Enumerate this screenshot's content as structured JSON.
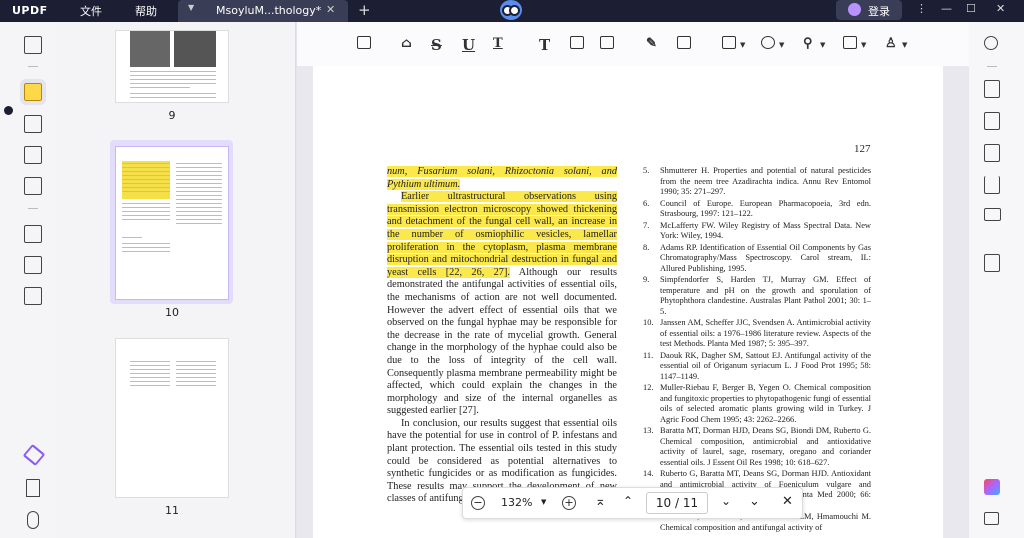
{
  "titlebar": {
    "logo": "UPDF",
    "menu_file": "文件",
    "menu_help": "帮助",
    "tab_title": "MsoyluM...thology*",
    "login": "登录"
  },
  "thumbnails": [
    {
      "page": "9"
    },
    {
      "page": "10"
    },
    {
      "page": "11"
    }
  ],
  "document": {
    "page_number": "127",
    "left_highlight_1": "num, Fusarium solani, Rhizoctonia solani, and Pythium ultimum.",
    "left_highlight_2": "Earlier ultrastructural observations using transmission electron microscopy showed thickening and detachment of the fungal cell wall, an increase in the number of osmiophilic vesicles, lamellar proliferation in the cytoplasm, plasma membrane disruption and mitochondrial destruction in fungal and yeast cells [22, 26, 27].",
    "left_plain_1": " Although our results demonstrated the antifungal activities of essential oils, the mechanisms of action are not well documented. However the advert effect of essential oils that we observed on the fungal hyphae may be responsible for the decrease in the rate of mycelial growth. General change in the morphology of the hyphae could also be due to the loss of integrity of the cell wall. Consequently plasma membrane permeability might be affected, which could explain the changes in the morphology and size of the internal organelles as suggested earlier [27].",
    "left_para_2": "In conclusion, our results suggest that essential oils have the potential for use in control of P. infestans and plant protection. The essential oils tested in this study could be considered as potential alternatives to synthetic fungicides or as modification as fungicides. These results may support the development of new classes of antifungal compounds.",
    "references": [
      {
        "n": "5.",
        "t": "Shmutterer H. Properties and potential of natural pesticides from the neem tree Azadirachta indica. Annu Rev Entomol 1990; 35: 271–297."
      },
      {
        "n": "6.",
        "t": "Council of Europe. European Pharmacopoeia, 3rd edn. Strasbourg, 1997: 121–122."
      },
      {
        "n": "7.",
        "t": "McLafferty FW. Wiley Registry of Mass Spectral Data. New York: Wiley, 1994."
      },
      {
        "n": "8.",
        "t": "Adams RP. Identification of Essential Oil Components by Gas Chromatography/Mass Spectroscopy. Carol stream, IL: Allured Publishing, 1995."
      },
      {
        "n": "9.",
        "t": "Simpfendorfer S, Harden TJ, Murray GM. Effect of temperature and pH on the growth and sporulation of Phytophthora clandestine. Australas Plant Pathol 2001; 30: 1–5."
      },
      {
        "n": "10.",
        "t": "Janssen AM, Scheffer JJC, Svendsen A. Antimicrobial activity of essential oils: a 1976–1986 literature review. Aspects of the test Methods. Planta Med 1987; 5: 395–397."
      },
      {
        "n": "11.",
        "t": "Daouk RK, Dagher SM, Sattout EJ. Antifungal activity of the essential oil of Origanum syriacum L. J Food Prot 1995; 58: 1147–1149."
      },
      {
        "n": "12.",
        "t": "Muller-Riebau F, Berger B, Yegen O. Chemical composition and fungitoxic properties to phytopathogenic fungi of essential oils of selected aromatic plants growing wild in Turkey. J Agric Food Chem 1995; 43: 2262–2266."
      },
      {
        "n": "13.",
        "t": "Baratta MT, Dorman HJD, Deans SG, Biondi DM, Ruberto G. Chemical composition, antimicrobial and antioxidative activity of laurel, sage, rosemary, oregano and coriander essential oils. J Essent Oil Res 1998; 10: 618–627."
      },
      {
        "n": "14.",
        "t": "Ruberto G, Baratta MT, Deans SG, Dorman HJD. Antioxidant and antimicrobial activity of Foeniculum vulgare and Crithmum maritimum essential oils. Planta Med 2000; 66: 687–693."
      },
      {
        "n": "15.",
        "t": "Bouchra C, Achouri M, Idrissi-Hassani LM, Hmamouchi M. Chemical composition and antifungal activity of"
      }
    ]
  },
  "pagenav": {
    "zoom": "132%",
    "current_page": "10",
    "separator": "/",
    "total_pages": "11"
  }
}
